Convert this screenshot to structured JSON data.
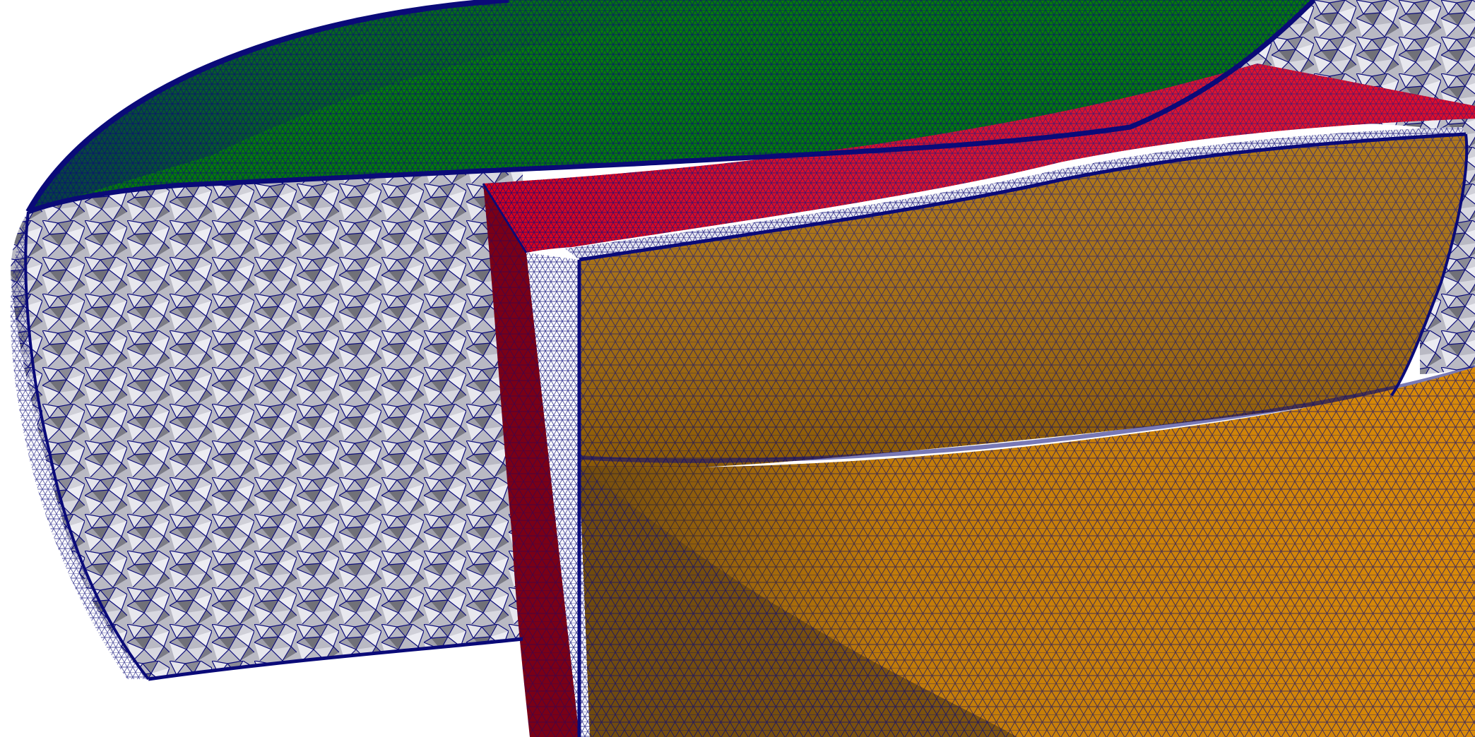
{
  "scene": {
    "background": "#ffffff",
    "regions": [
      {
        "id": "top-surface",
        "fill": "#047a0b"
      },
      {
        "id": "bulk-volume",
        "fill": "#b9b9c3"
      },
      {
        "id": "ring-top",
        "fill": "#d5001c"
      },
      {
        "id": "ring-side",
        "fill": "#7a0016"
      },
      {
        "id": "insert-wall",
        "fill": "#a86c06"
      },
      {
        "id": "insert-floor",
        "fill": "#d98a08"
      },
      {
        "id": "insert-shadow",
        "fill": "#6e4a10"
      }
    ],
    "mesh_edge_color": "#0a0a78",
    "mesh_element": "triangle"
  }
}
